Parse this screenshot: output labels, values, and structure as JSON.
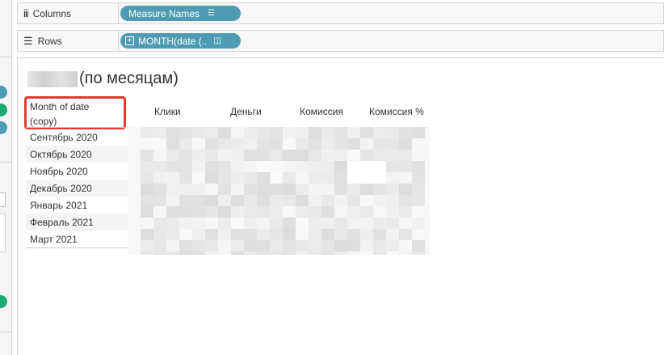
{
  "shelves": {
    "columns": {
      "label": "Columns",
      "icon": "columns-icon",
      "pill": "Measure Names"
    },
    "rows": {
      "label": "Rows",
      "icon": "rows-icon",
      "pill": "MONTH(date (.."
    }
  },
  "view": {
    "title_suffix": "(по месяцам)",
    "row_header": [
      "Month of date",
      "(copy)"
    ],
    "column_headers": [
      "Клики",
      "Деньги",
      "Комиссия",
      "Комиссия %"
    ],
    "months": [
      "Сентябрь 2020",
      "Октябрь 2020",
      "Ноябрь 2020",
      "Декабрь 2020",
      "Январь 2021",
      "Февраль 2021",
      "Март 2021"
    ]
  },
  "colors": {
    "pill": "#4e9cb4",
    "highlight": "#e03c31",
    "green_pill": "#19a974"
  }
}
